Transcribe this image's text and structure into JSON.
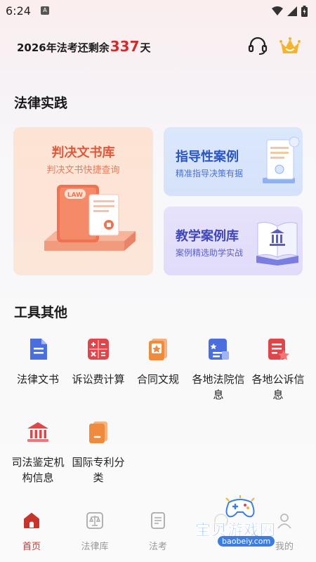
{
  "status": {
    "time": "6:24"
  },
  "header": {
    "prefix": "2026年法考还剩余",
    "days": "337",
    "suffix": "天"
  },
  "practice": {
    "title": "法律实践",
    "big_card": {
      "title": "判决文书库",
      "subtitle": "判决文书快捷查询",
      "badge": "LAW"
    },
    "guide_card": {
      "title": "指导性案例",
      "subtitle": "精准指导决策有据"
    },
    "teach_card": {
      "title": "教学案例库",
      "subtitle": "案例精选助学实战"
    }
  },
  "tools": {
    "title": "工具其他",
    "items": [
      {
        "label": "法律文书",
        "icon": "document-icon",
        "color": "#4a6ee0"
      },
      {
        "label": "诉讼费计算",
        "icon": "calculator-icon",
        "color": "#e0454a"
      },
      {
        "label": "合同文规",
        "icon": "contract-icon",
        "color": "#f08a3c"
      },
      {
        "label": "各地法院信息",
        "icon": "court-list-icon",
        "color": "#4a6ee0"
      },
      {
        "label": "各地公诉信息",
        "icon": "prosecution-icon",
        "color": "#e0454a"
      },
      {
        "label": "司法鉴定机构信息",
        "icon": "institution-icon",
        "color": "#e0454a"
      },
      {
        "label": "国际专利分类",
        "icon": "patent-book-icon",
        "color": "#f08a3c"
      }
    ]
  },
  "tabbar": {
    "items": [
      {
        "label": "首页",
        "icon": "home-icon",
        "active": true
      },
      {
        "label": "法律库",
        "icon": "scale-icon",
        "active": false
      },
      {
        "label": "法考",
        "icon": "exam-icon",
        "active": false
      },
      {
        "label": "",
        "icon": "hidden-tab-icon",
        "active": false
      },
      {
        "label": "我的",
        "icon": "profile-icon",
        "active": false
      }
    ]
  },
  "watermark": {
    "text": "宝贝游戏网",
    "url": "baobeiy.com"
  },
  "colors": {
    "accent": "#c8342b",
    "count_red": "#d12c2c",
    "crown": "#f4b52c"
  }
}
